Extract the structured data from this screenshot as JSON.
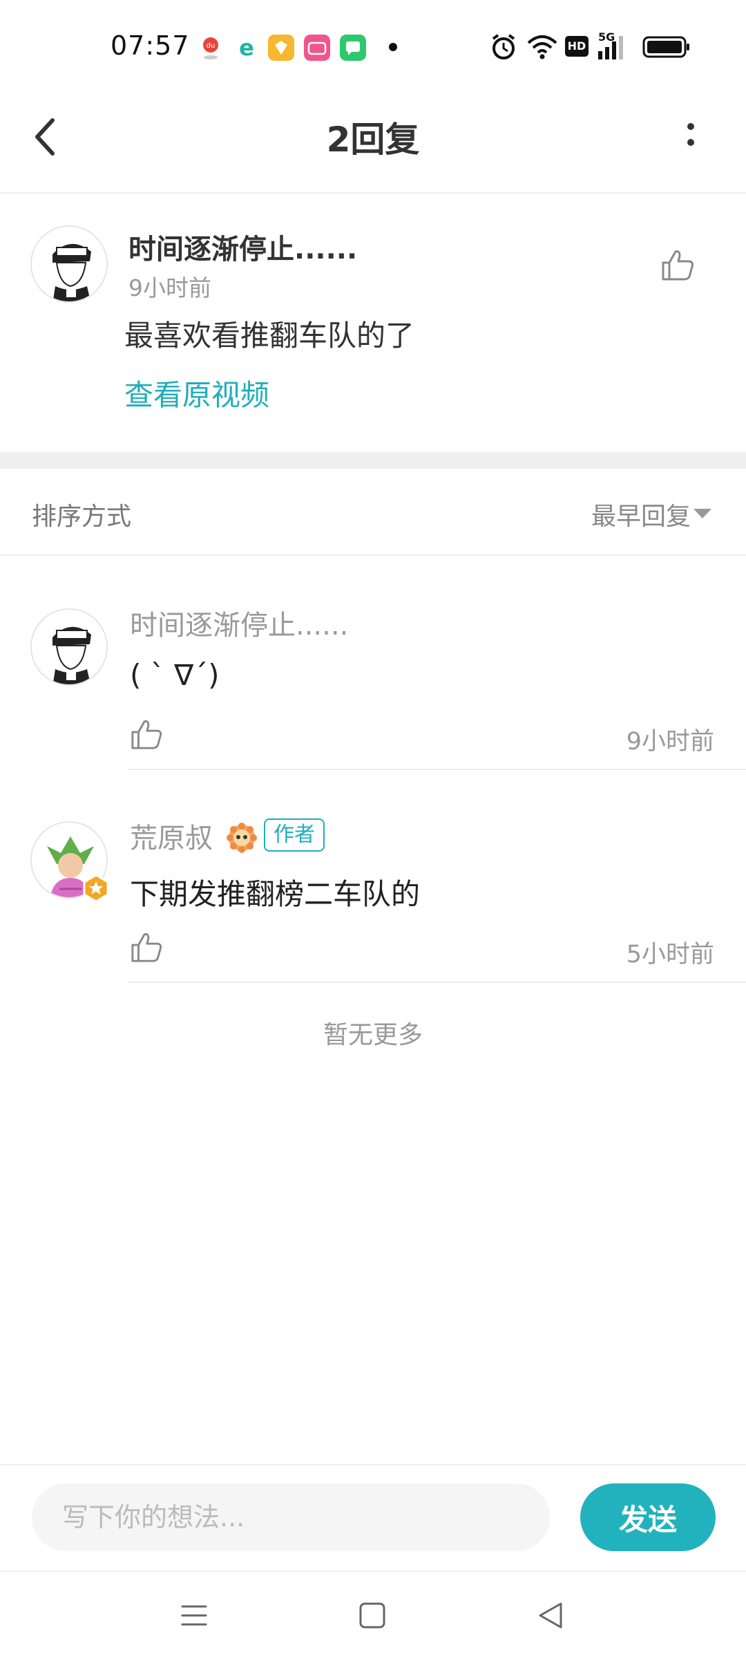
{
  "status_bar": {
    "time": "07:57",
    "hd_label": "HD",
    "network_label": "5G",
    "icons": [
      "map-pin-icon",
      "browser-e-icon",
      "yellow-app-icon",
      "bilibili-icon",
      "chat-app-icon",
      "notification-dot-icon",
      "alarm-icon",
      "wifi-icon",
      "hd-icon",
      "signal-5g-icon",
      "battery-icon"
    ],
    "app_colors": {
      "yellow": "#f5b82e",
      "pink": "#f0568c",
      "green": "#2ec86f",
      "teal": "#18b6a4"
    }
  },
  "header": {
    "title": "2回复",
    "back_icon": "back-arrow-icon",
    "more_icon": "more-vertical-icon"
  },
  "original_comment": {
    "username": "时间逐渐停止......",
    "time": "9小时前",
    "text": "最喜欢看推翻车队的了",
    "link": "查看原视频",
    "like_icon": "thumbs-up-icon"
  },
  "sort": {
    "label": "排序方式",
    "value": "最早回复",
    "caret_icon": "caret-down-icon"
  },
  "replies": [
    {
      "username": "时间逐渐停止......",
      "text": "( ˋ ∇ˊ)",
      "time": "9小时前",
      "is_author": false
    },
    {
      "username": "荒原叔",
      "text": "下期发推翻榜二车队的",
      "time": "5小时前",
      "is_author": true,
      "badge_icon": "sunflower-badge-icon",
      "author_tag": "作者"
    }
  ],
  "no_more_text": "暂无更多",
  "input": {
    "placeholder": "写下你的想法...",
    "send_label": "发送"
  },
  "nav": {
    "icons": [
      "menu-icon",
      "home-square-icon",
      "back-triangle-icon"
    ]
  },
  "colors": {
    "accent": "#21aeb9",
    "send_button": "#22b2bd",
    "muted_text": "#999999"
  }
}
